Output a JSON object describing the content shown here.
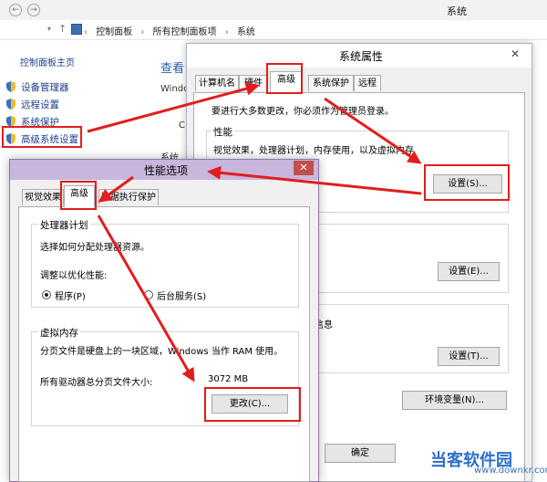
{
  "system_window": {
    "title": "系统",
    "nav": {
      "back": "←",
      "forward": "→",
      "up": "↑"
    },
    "breadcrumb": [
      "控制面板",
      "所有控制面板项",
      "系统"
    ],
    "breadcrumb_sep": "›",
    "sidebar": {
      "home": "控制面板主页",
      "items": [
        {
          "label": "设备管理器",
          "icon": "shield-icon"
        },
        {
          "label": "远程设置",
          "icon": "shield-icon"
        },
        {
          "label": "系统保护",
          "icon": "shield-icon"
        },
        {
          "label": "高级系统设置",
          "icon": "shield-icon"
        }
      ]
    },
    "main_heading_fragment": "查看",
    "main_text_fragment_1": "Windo",
    "main_text_fragment_2": "系统"
  },
  "system_properties": {
    "title": "系统属性",
    "close": "✕",
    "tabs": [
      "计算机名",
      "硬件",
      "高级",
      "系统保护",
      "远程"
    ],
    "active_tab": "高级",
    "admin_note": "要进行大多数更改，你必须作为管理员登录。",
    "performance": {
      "label": "性能",
      "desc": "视觉效果，处理器计划，内存使用，以及虚拟内存",
      "settings_button": "设置(S)..."
    },
    "user_profiles": {
      "settings_button": "设置(E)..."
    },
    "startup": {
      "label_fragment": "信息",
      "settings_button": "设置(T)..."
    },
    "env_button": "环境变量(N)...",
    "ok_button": "确定",
    "fragment_char": "C"
  },
  "performance_options": {
    "title": "性能选项",
    "close": "✕",
    "tabs": [
      "视觉效果",
      "高级",
      "数据执行保护"
    ],
    "active_tab": "高级",
    "processor": {
      "label": "处理器计划",
      "desc": "选择如何分配处理器资源。",
      "adjust_label": "调整以优化性能:",
      "options": [
        "程序(P)",
        "后台服务(S)"
      ],
      "selected": "程序(P)"
    },
    "virtual_memory": {
      "label": "虚拟内存",
      "desc": "分页文件是硬盘上的一块区域，Windows 当作 RAM 使用。",
      "total_label": "所有驱动器总分页文件大小:",
      "total_value": "3072 MB",
      "change_button": "更改(C)..."
    }
  },
  "watermark": {
    "cn": "当客软件园",
    "url": "www.downkr.com"
  },
  "colors": {
    "highlight": "#e21d1d",
    "arrow": "#e21d1d",
    "link": "#1f3e8a"
  }
}
